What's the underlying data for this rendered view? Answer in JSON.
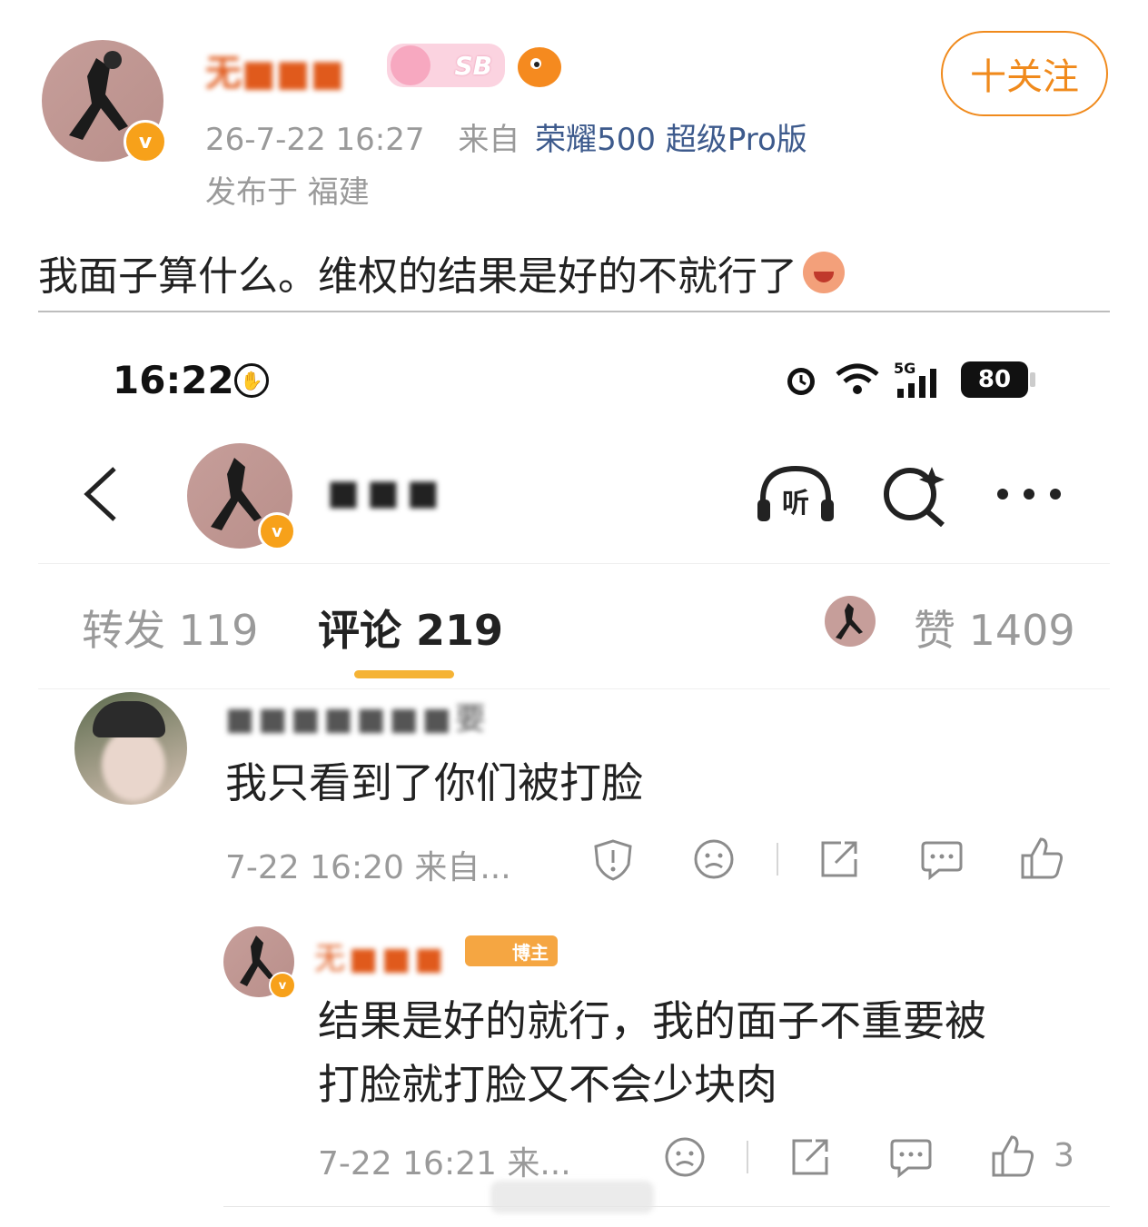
{
  "post": {
    "username_masked": "无■■■",
    "meta_time": "26-7-22 16:27",
    "meta_from_label": "来自",
    "meta_device": "荣耀500 超级Pro版",
    "location": "发布于 福建",
    "follow_label": "十关注",
    "sb_badge": "SB",
    "text": "我面子算什么。维权的结果是好的不就行了"
  },
  "screenshot": {
    "status": {
      "time": "16:22",
      "net": "5G",
      "battery": "80"
    },
    "header": {
      "username_masked": "■■■"
    },
    "tabs": [
      {
        "label": "转发 119"
      },
      {
        "label": "评论 219"
      },
      {
        "label": "赞 1409"
      }
    ],
    "comments": [
      {
        "username_masked": "■■■■■■■要",
        "text": "我只看到了你们被打脸",
        "meta": "7-22 16:20 来自..."
      },
      {
        "username_masked": "无■■■",
        "badge": "博主",
        "text_line1": "结果是好的就行，我的面子不重要被",
        "text_line2": "打脸就打脸又不会少块肉",
        "meta": "7-22 16:21 来...",
        "likes": "3"
      }
    ]
  },
  "colors": {
    "accent": "#f08a1c",
    "link": "#3d5a8c",
    "vbadge": "#f7a11a",
    "tab_underline": "#f5b335"
  }
}
